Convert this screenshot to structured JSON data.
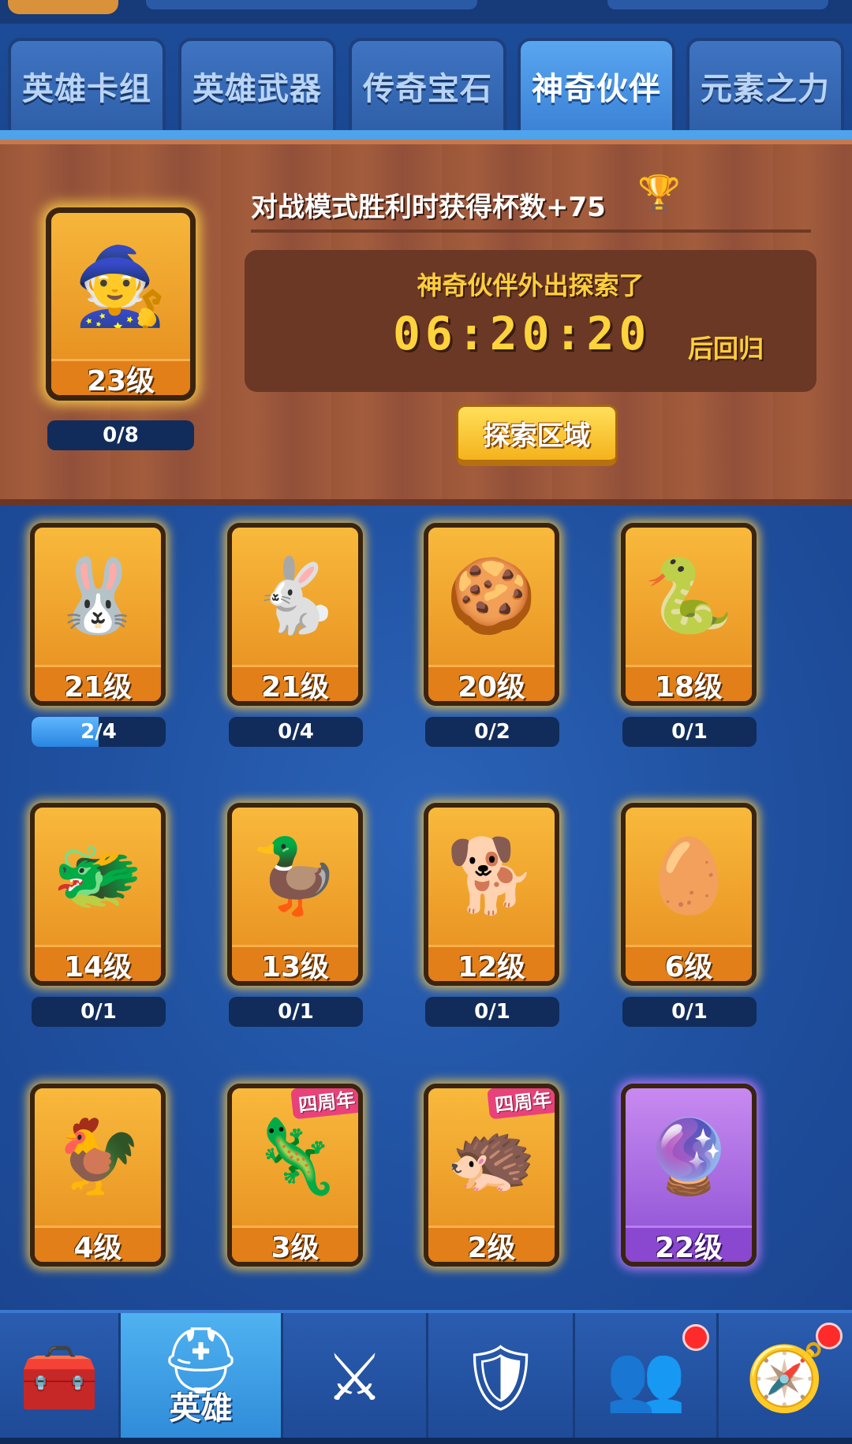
{
  "tabs": [
    {
      "label": "英雄卡组",
      "active": false
    },
    {
      "label": "英雄武器",
      "active": false
    },
    {
      "label": "传奇宝石",
      "active": false
    },
    {
      "label": "神奇伙伴",
      "active": true
    },
    {
      "label": "元素之力",
      "active": false
    }
  ],
  "featured": {
    "icon": "old-sage-icon",
    "level": "23级",
    "progress_label": "0/8",
    "progress_fraction": 0,
    "bonus": "对战模式胜利时获得杯数+75",
    "explore_status": "神奇伙伴外出探索了",
    "timer": "06:20:20",
    "timer_suffix": "后回归",
    "explore_button": "探索区域"
  },
  "companions": [
    {
      "icon": "bunny-tophat-icon",
      "glyph": "🐰",
      "level": "21级",
      "progress": "2/4",
      "progress_fraction": 0.5
    },
    {
      "icon": "bunny-bow-icon",
      "glyph": "🐇",
      "level": "21级",
      "progress": "0/4",
      "progress_fraction": 0
    },
    {
      "icon": "gingerbread-icon",
      "glyph": "🍪",
      "level": "20级",
      "progress": "0/2",
      "progress_fraction": 0
    },
    {
      "icon": "snake-icon",
      "glyph": "🐍",
      "level": "18级",
      "progress": "0/1",
      "progress_fraction": 0
    },
    {
      "icon": "dragon-icon",
      "glyph": "🐲",
      "level": "14级",
      "progress": "0/1",
      "progress_fraction": 0
    },
    {
      "icon": "duck-icon",
      "glyph": "🦆",
      "level": "13级",
      "progress": "0/1",
      "progress_fraction": 0
    },
    {
      "icon": "dog-icon",
      "glyph": "🐕",
      "level": "12级",
      "progress": "0/1",
      "progress_fraction": 0
    },
    {
      "icon": "golden-egg-icon",
      "glyph": "🥚",
      "level": "6级",
      "progress": "0/1",
      "progress_fraction": 0
    },
    {
      "icon": "rooster-icon",
      "glyph": "🐓",
      "level": "4级",
      "progress": "",
      "progress_fraction": 0
    },
    {
      "icon": "axolotl-icon",
      "glyph": "🦎",
      "level": "3级",
      "badge": "四周年",
      "progress": "",
      "progress_fraction": 0
    },
    {
      "icon": "furry-creature-icon",
      "glyph": "🦔",
      "level": "2级",
      "badge": "四周年",
      "progress": "",
      "progress_fraction": 0
    },
    {
      "icon": "crystal-orb-icon",
      "glyph": "🔮",
      "level": "22级",
      "rarity": "purple",
      "progress": "",
      "progress_fraction": 0
    }
  ],
  "bottom_nav": [
    {
      "icon": "treasure-chest-icon",
      "glyph": "🧰",
      "label": "",
      "active": false,
      "notification": false
    },
    {
      "icon": "knight-helmet-icon",
      "glyph": "⛑",
      "label": "英雄",
      "active": true,
      "notification": false
    },
    {
      "icon": "crossed-swords-icon",
      "glyph": "⚔",
      "label": "",
      "active": false,
      "notification": false
    },
    {
      "icon": "crown-shield-icon",
      "glyph": "🛡",
      "label": "",
      "active": false,
      "notification": false
    },
    {
      "icon": "guild-banner-icon",
      "glyph": "👥",
      "label": "",
      "active": false,
      "notification": true
    },
    {
      "icon": "compass-icon",
      "glyph": "🧭",
      "label": "",
      "active": false,
      "notification": true
    }
  ],
  "colors": {
    "accent_gold": "#ffd33c",
    "background_blue": "#1e4fa0",
    "panel_brown": "#9a5638",
    "notification_red": "#ff2a2a"
  }
}
